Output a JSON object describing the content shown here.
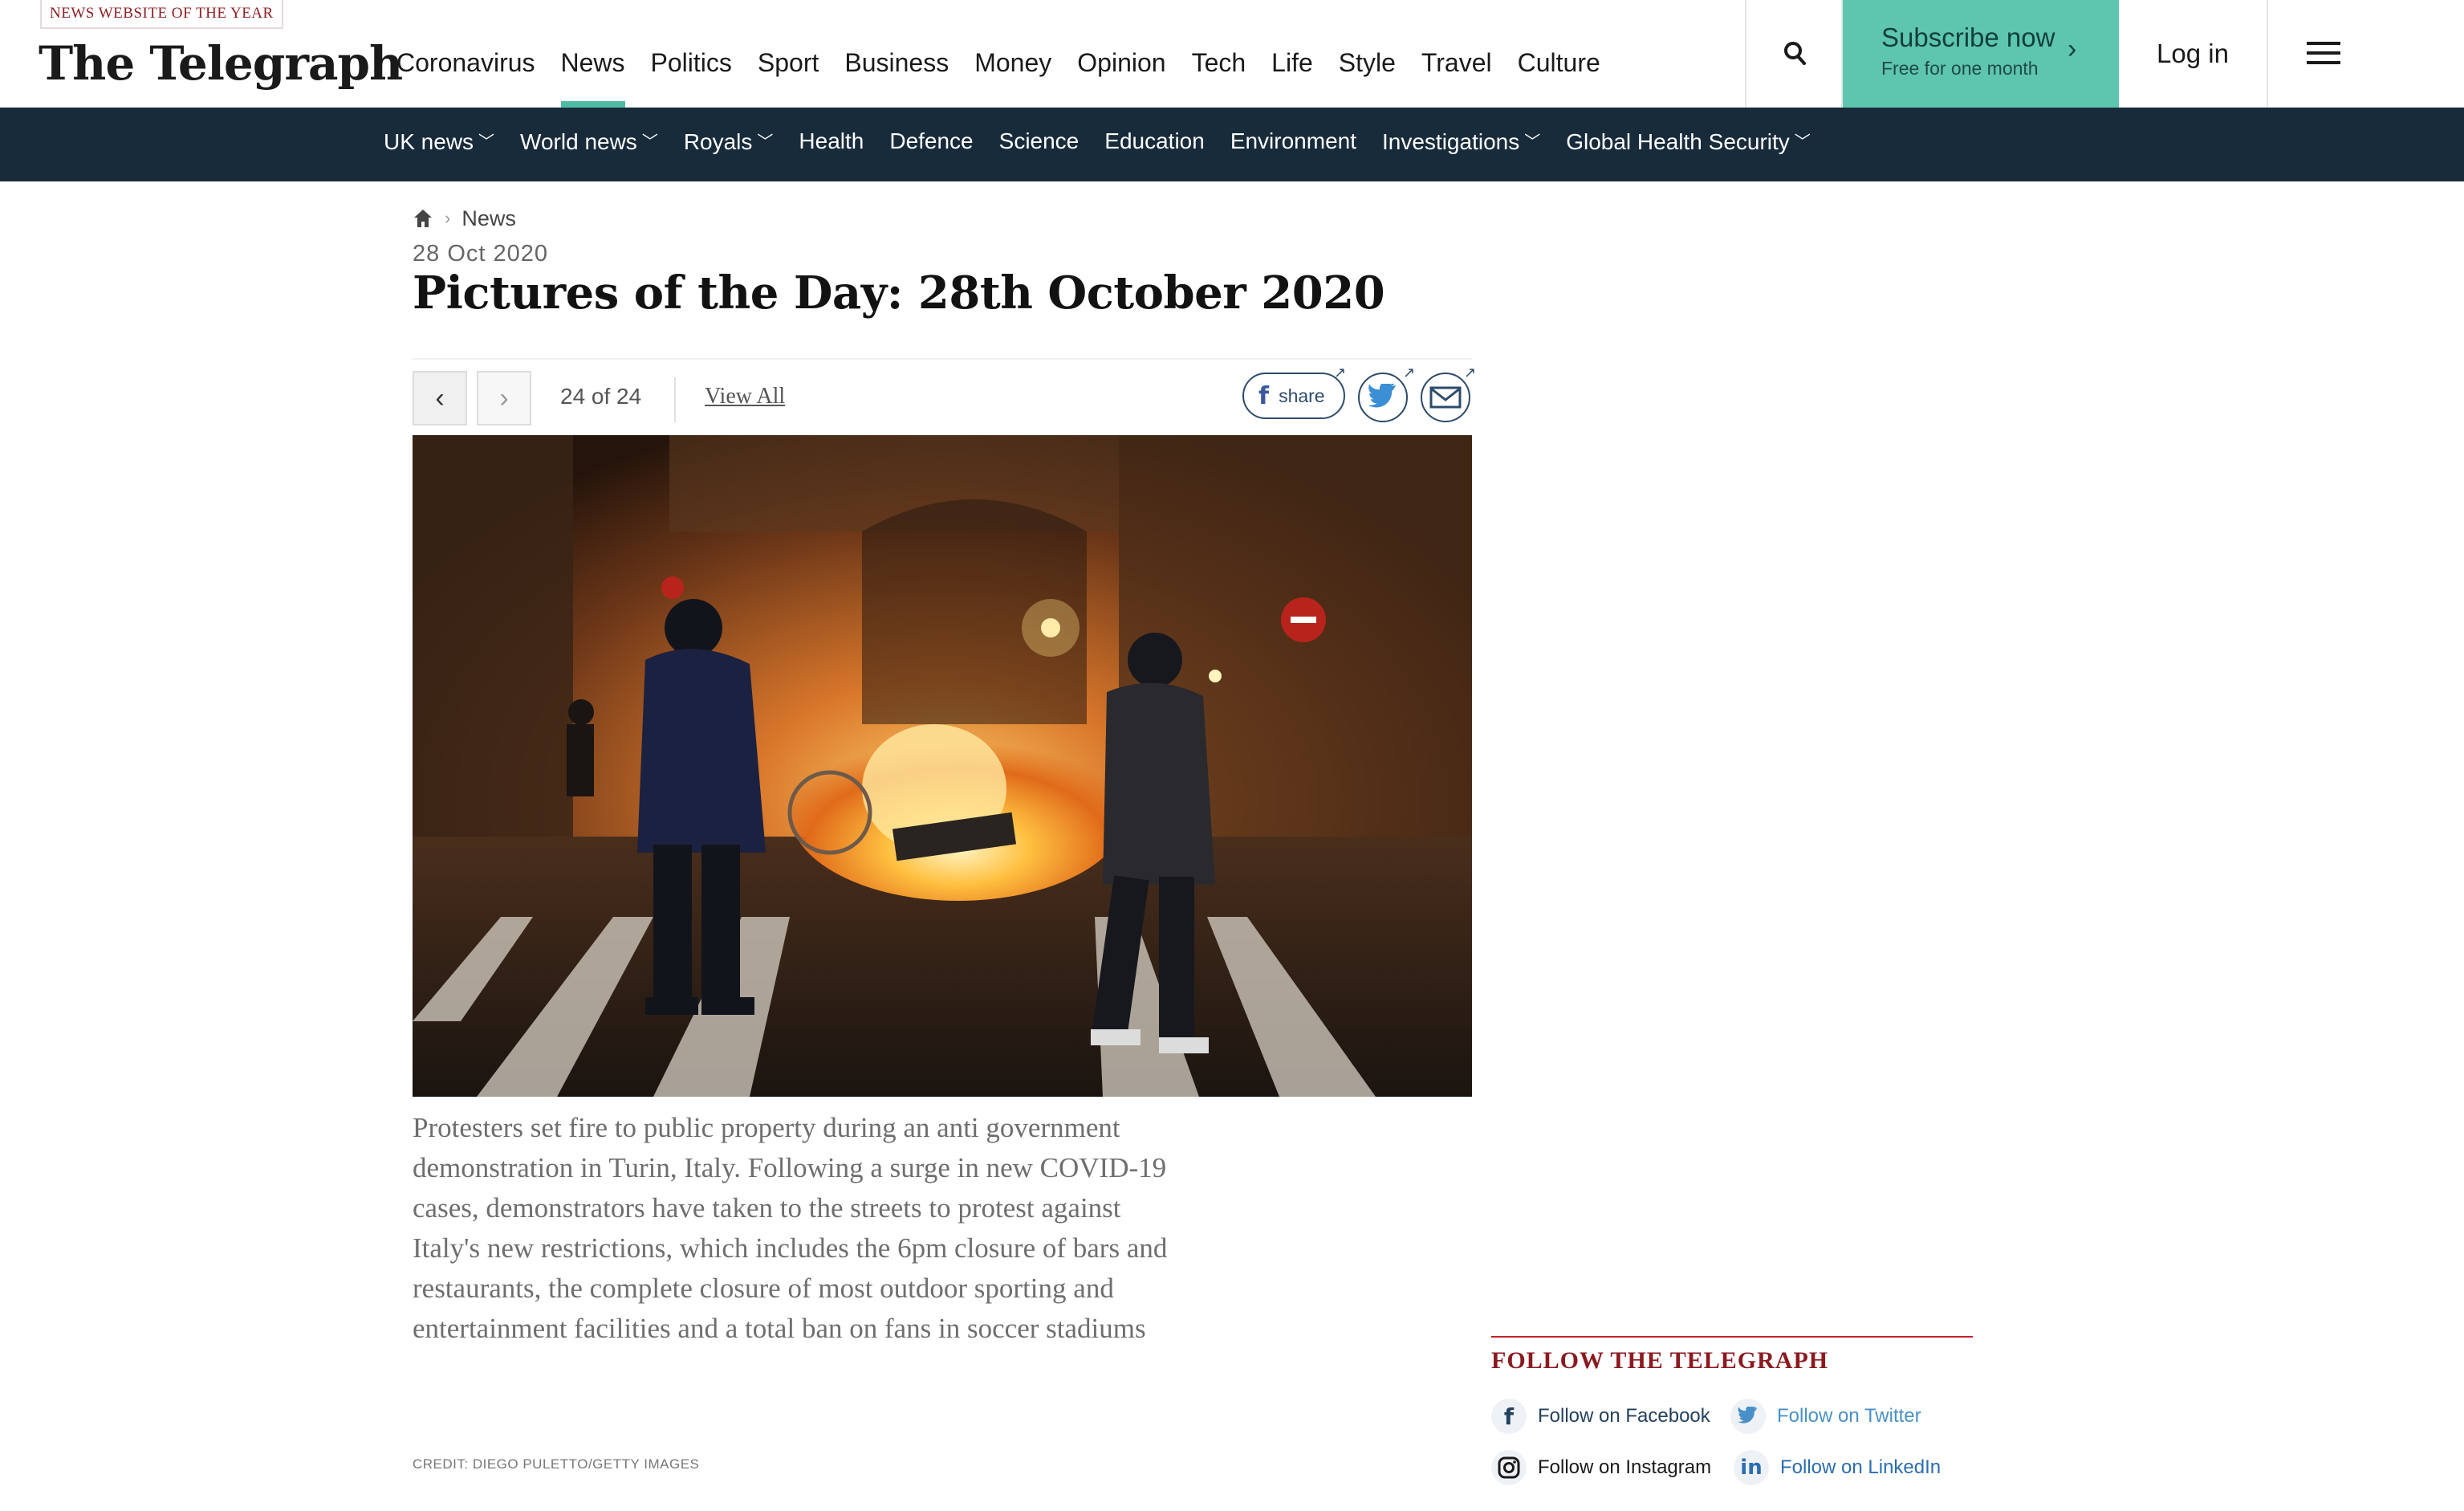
{
  "header": {
    "award": "NEWS WEBSITE OF THE YEAR",
    "logo": "The Telegraph",
    "nav": [
      "Coronavirus",
      "News",
      "Politics",
      "Sport",
      "Business",
      "Money",
      "Opinion",
      "Tech",
      "Life",
      "Style",
      "Travel",
      "Culture"
    ],
    "active_nav": "News",
    "subscribe_label": "Subscribe now",
    "subscribe_sub": "Free for one month",
    "login_label": "Log in",
    "accent_color": "#5ec5ae"
  },
  "subnav": {
    "items": [
      {
        "label": "UK news",
        "dropdown": true
      },
      {
        "label": "World news",
        "dropdown": true
      },
      {
        "label": "Royals",
        "dropdown": true
      },
      {
        "label": "Health",
        "dropdown": false
      },
      {
        "label": "Defence",
        "dropdown": false
      },
      {
        "label": "Science",
        "dropdown": false
      },
      {
        "label": "Education",
        "dropdown": false
      },
      {
        "label": "Environment",
        "dropdown": false
      },
      {
        "label": "Investigations",
        "dropdown": true
      },
      {
        "label": "Global Health Security",
        "dropdown": true
      }
    ],
    "background_color": "#182b3b"
  },
  "article": {
    "breadcrumb": "News",
    "date": "28 Oct 2020",
    "title": "Pictures of the Day: 28th October 2020",
    "counter": "24 of 24",
    "view_all": "View All",
    "share_label": "share",
    "caption": "Protesters set fire to public property during an anti government demonstration in Turin, Italy. Following a surge in new COVID-19 cases, demonstrators have taken to the streets to protest against Italy's new restrictions, which includes the 6pm closure of bars and restaurants, the complete closure of most outdoor sporting and entertainment facilities and a total ban on fans in soccer stadiums",
    "credit": "CREDIT: DIEGO PULETTO/GETTY IMAGES"
  },
  "follow": {
    "heading": "FOLLOW THE TELEGRAPH",
    "links": [
      {
        "label": "Follow on Facebook",
        "icon": "facebook-icon",
        "color": "#23415f"
      },
      {
        "label": "Follow on Twitter",
        "icon": "twitter-icon",
        "color": "#4a90c8"
      },
      {
        "label": "Follow on Instagram",
        "icon": "instagram-icon",
        "color": "#1a1a1a"
      },
      {
        "label": "Follow on LinkedIn",
        "icon": "linkedin-icon",
        "color": "#2c6cb0"
      }
    ]
  }
}
